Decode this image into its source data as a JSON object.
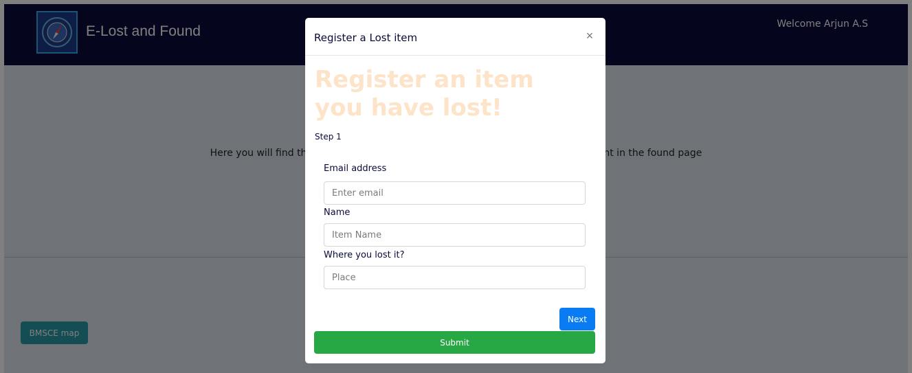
{
  "navbar": {
    "brand": "E-Lost and Found",
    "welcome": "Welcome Arjun A.S"
  },
  "main": {
    "intro": "Here you will find the list of items that have been lost. Check if your item is present in the found page",
    "map_button": "BMSCE map"
  },
  "modal": {
    "title": "Register a Lost item",
    "close_symbol": "×",
    "heading": "Register an item you have lost!",
    "step": "Step 1",
    "fields": [
      {
        "label": "Email address",
        "placeholder": "Enter email"
      },
      {
        "label": "Name",
        "placeholder": "Item Name"
      },
      {
        "label": "Where you lost it?",
        "placeholder": "Place"
      }
    ],
    "next_button": "Next",
    "submit_button": "Submit"
  },
  "colors": {
    "navbar": "#0a0a3a",
    "heading": "#fde3c8",
    "next": "#0a7cf3",
    "submit": "#28a745",
    "map": "#2a9aa8"
  },
  "icons": {
    "logo": "compass-icon",
    "close": "close-icon"
  }
}
